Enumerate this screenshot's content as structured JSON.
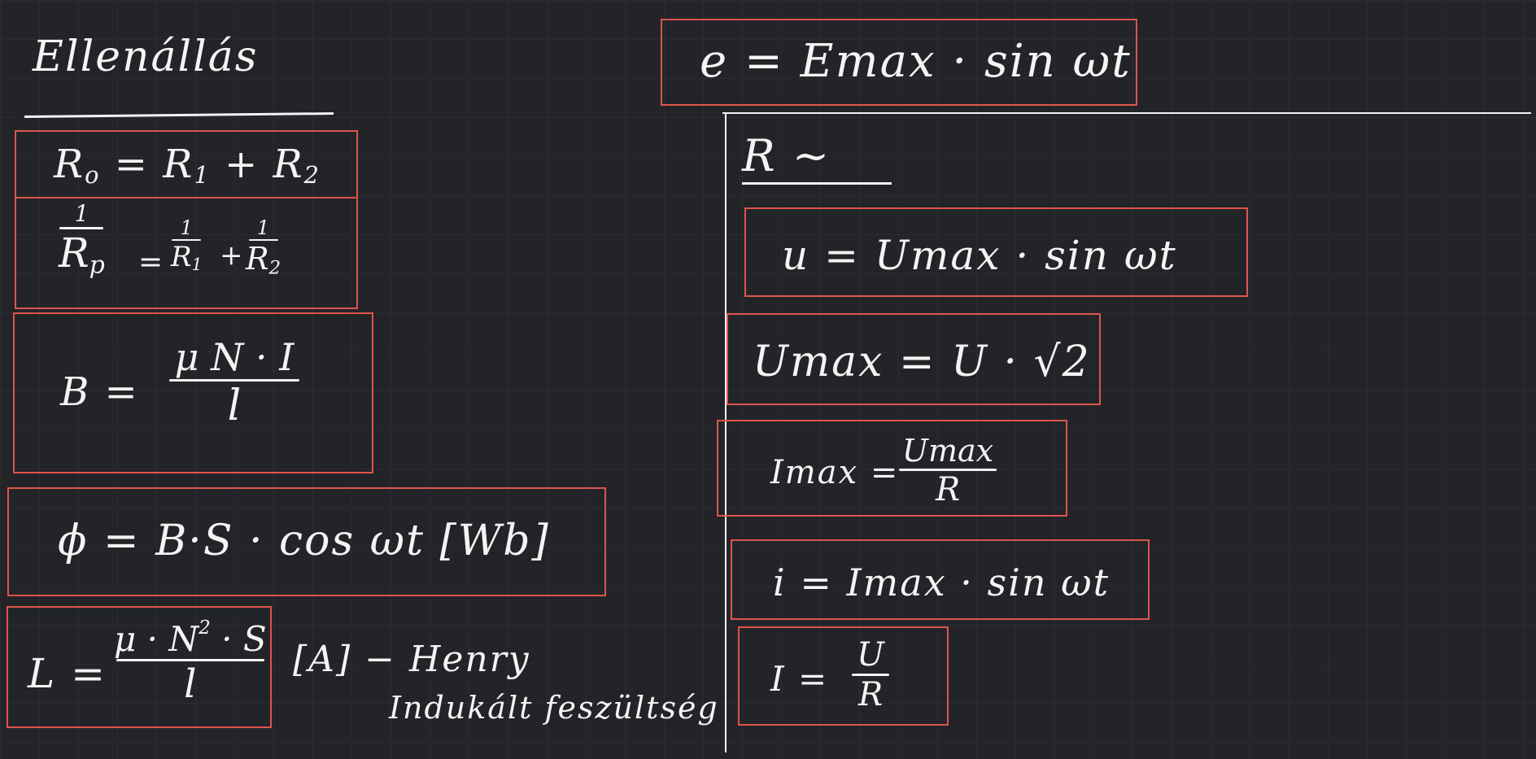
{
  "left": {
    "heading": "Ellenállás",
    "series": {
      "lhs": "R",
      "lhs_sub": "o",
      "rhs": "= R",
      "r1": "1",
      "plus": " + R",
      "r2": "2"
    },
    "parallel": {
      "one": "1",
      "lhs": "R",
      "lhs_sub": "p",
      "eq": "=",
      "t1_num": "1",
      "t1_den": "R",
      "t1_sub": "1",
      "plus": "+",
      "t2_num": "1",
      "t2_den": "R",
      "t2_sub": "2"
    },
    "b_field": {
      "lhs": "B =",
      "num": "μ N · I",
      "den": "l"
    },
    "flux": {
      "text": "ϕ = B·S · cos ωt [Wb]"
    },
    "inductance": {
      "lhs": "L =",
      "num_pre": "μ · N",
      "num_sup": "2",
      "num_post": " · S",
      "den": "l"
    },
    "note_unit": "[A] − Henry",
    "note_text": "Indukált feszültség"
  },
  "right": {
    "emf": "e = Emax · sin ωt",
    "section": "R ~",
    "u": "u = Umax · sin ωt",
    "umax": "Umax = U · √2",
    "imax": {
      "lhs": "Imax =",
      "num": "Umax",
      "den": "R"
    },
    "i": "i = Imax · sin ωt",
    "ohm": {
      "lhs": "I =",
      "num": "U",
      "den": "R"
    }
  },
  "colors": {
    "background": "#232428",
    "box": "#e0544d",
    "ink": "#f4f4f4"
  }
}
